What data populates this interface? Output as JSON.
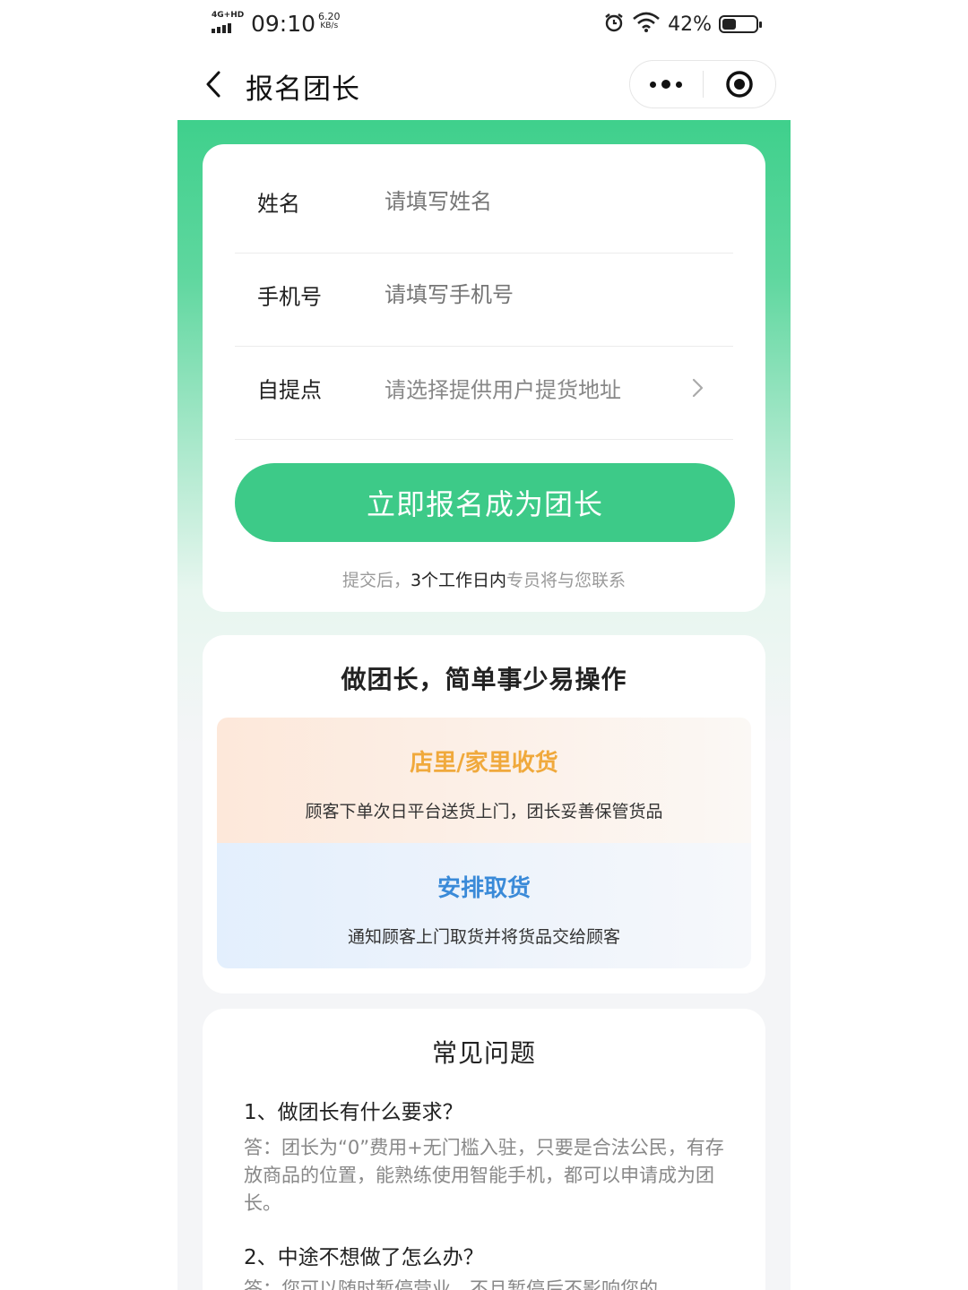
{
  "status_bar": {
    "network": "4G+HD",
    "time": "09:10",
    "speed_value": "6.20",
    "speed_unit": "KB/s",
    "battery_percent": "42%",
    "battery_level": 0.42
  },
  "nav": {
    "title": "报名团长"
  },
  "form": {
    "fields": [
      {
        "label": "姓名",
        "placeholder": "请填写姓名"
      },
      {
        "label": "手机号",
        "placeholder": "请填写手机号"
      },
      {
        "label": "自提点",
        "placeholder": "请选择提供用户提货地址"
      }
    ],
    "submit_label": "立即报名成为团长",
    "note_prefix": "提交后，",
    "note_strong": "3个工作日内",
    "note_suffix": "专员将与您联系"
  },
  "intro": {
    "title": "做团长，简单事少易操作",
    "features": [
      {
        "title": "店里/家里收货",
        "desc": "顾客下单次日平台送货上门，团长妥善保管货品",
        "color": "#f0a93c"
      },
      {
        "title": "安排取货",
        "desc": "通知顾客上门取货并将货品交给顾客",
        "color": "#3a8ad8"
      }
    ]
  },
  "faq": {
    "title": "常见问题",
    "items": [
      {
        "question": "1、做团长有什么要求？",
        "answer": "答：团长为“0”费用+无门槛入驻，只要是合法公民，有存放商品的位置，能熟练使用智能手机，都可以申请成为团长。"
      },
      {
        "question": "2、中途不想做了怎么办？",
        "answer": "答：您可以随时暂停营业，不且暂停后不影响您的"
      }
    ]
  },
  "colors": {
    "brand_green": "#3dca88",
    "feature_orange": "#f0a93c",
    "feature_blue": "#3a8ad8"
  }
}
